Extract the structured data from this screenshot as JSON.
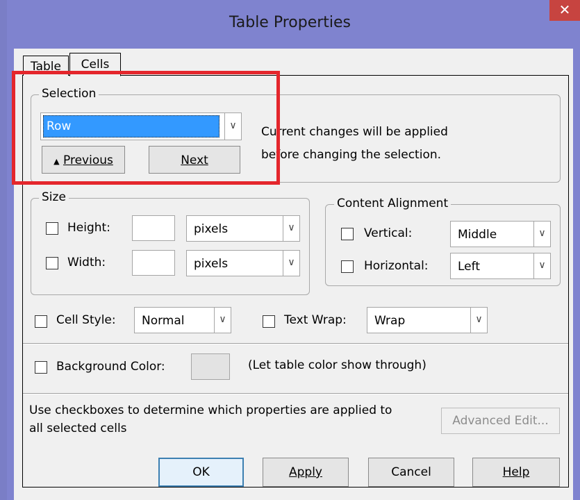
{
  "window": {
    "title": "Table Properties",
    "close_glyph": "✕"
  },
  "tabs": [
    {
      "label": "Table"
    },
    {
      "label": "Cells"
    }
  ],
  "selection": {
    "legend": "Selection",
    "value": "Row",
    "prev_glyph": "▲",
    "prev_label": "Previous",
    "next_label": "Next",
    "note_line1": "Current changes will be applied",
    "note_line2": "before changing the selection."
  },
  "size": {
    "legend": "Size",
    "height_label": "Height:",
    "height_value": "",
    "height_unit": "pixels",
    "width_label": "Width:",
    "width_value": "",
    "width_unit": "pixels"
  },
  "alignment": {
    "legend": "Content Alignment",
    "vertical_label": "Vertical:",
    "vertical_value": "Middle",
    "horizontal_label": "Horizontal:",
    "horizontal_value": "Left"
  },
  "cell_style": {
    "label": "Cell Style:",
    "value": "Normal"
  },
  "text_wrap": {
    "label": "Text Wrap:",
    "value": "Wrap"
  },
  "background": {
    "label": "Background Color:",
    "note": "(Let table color show through)"
  },
  "hint_line1": "Use checkboxes to determine which properties are applied to",
  "hint_line2": "all selected cells",
  "advanced_edit": "Advanced Edit...",
  "buttons": {
    "ok": "OK",
    "apply": "Apply",
    "cancel": "Cancel",
    "help": "Help"
  },
  "colors": {
    "title_bar": "#7f83cf",
    "close": "#c74440",
    "highlight": "#e4262c",
    "selection_fill": "#3399ff"
  }
}
